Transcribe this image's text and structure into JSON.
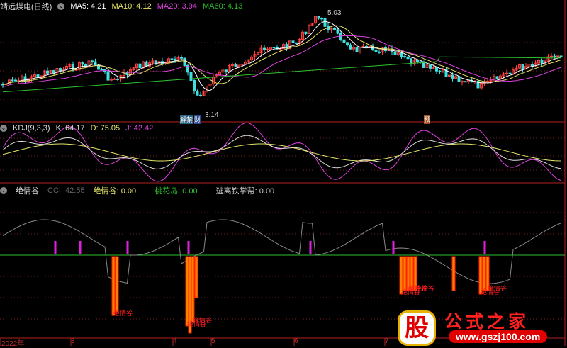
{
  "main_panel": {
    "title": "靖远煤电(日线)",
    "ma5": "MA5: 4.21",
    "ma10": "MA10: 4.12",
    "ma20": "MA20: 3.94",
    "ma60": "MA60: 4.13",
    "high_label": "5.03",
    "low_label": "3.14",
    "markers": [
      "解禁",
      "财",
      "预"
    ],
    "colors": {
      "ma5": "#ffffff",
      "ma10": "#e6e66a",
      "ma20": "#e040e0",
      "ma60": "#2ec02e",
      "up": "#ff4040",
      "down": "#40e0e0"
    }
  },
  "kdj_panel": {
    "title": "KDJ(9,3,3)",
    "k": "K: 64.17",
    "d": "D: 75.05",
    "j": "J: 42.42"
  },
  "indicator_panel": {
    "title": "绝情谷",
    "cci": "CCI: 42.55",
    "jqg": "绝情谷: 0.00",
    "thd": "桃花岛: 0.00",
    "tzb": "逃离铁掌帮: 0.00",
    "bar_label": "绝情谷"
  },
  "x_axis": {
    "labels": [
      "2022年",
      "3",
      "4",
      "5",
      "6",
      "7"
    ]
  },
  "watermark": {
    "char": "股",
    "text": "公式之家",
    "url": "www.gszj100.com"
  }
}
